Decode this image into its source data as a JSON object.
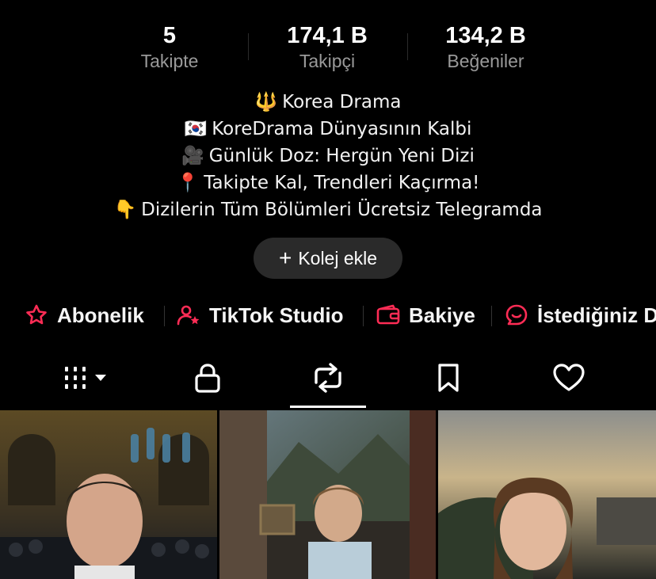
{
  "stats": [
    {
      "value": "5",
      "label": "Takipte"
    },
    {
      "value": "174,1 B",
      "label": "Takipçi"
    },
    {
      "value": "134,2 B",
      "label": "Beğeniler"
    }
  ],
  "bio": [
    {
      "emoji": "🔱",
      "text": "Korea Drama"
    },
    {
      "emoji": "🇰🇷",
      "text": "KoreDrama Dünyasının Kalbi"
    },
    {
      "emoji": "🎥",
      "text": "Günlük Doz: Hergün Yeni Dizi"
    },
    {
      "emoji": "📍",
      "text": "Takipte Kal, Trendleri Kaçırma!"
    },
    {
      "emoji": "👇",
      "text": "Dizilerin Tüm Bölümleri Ücretsiz Telegramda"
    }
  ],
  "add_collection": {
    "label": "Kolej ekle"
  },
  "links": [
    {
      "label": "Abonelik",
      "icon": "subscription-icon"
    },
    {
      "label": "TikTok Studio",
      "icon": "studio-icon"
    },
    {
      "label": "Bakiye",
      "icon": "wallet-icon"
    },
    {
      "label": "İstediğiniz D",
      "icon": "chat-icon"
    }
  ],
  "tabs": [
    {
      "name": "videos",
      "icon": "grid-icon"
    },
    {
      "name": "private",
      "icon": "lock-icon"
    },
    {
      "name": "reposts",
      "icon": "repost-icon",
      "active": true
    },
    {
      "name": "favorites",
      "icon": "bookmark-icon"
    },
    {
      "name": "liked",
      "icon": "heart-icon"
    }
  ],
  "colors": {
    "accent": "#fe2c55",
    "muted": "#9a9a9a",
    "background": "#000000",
    "button": "#2a2a2a"
  }
}
